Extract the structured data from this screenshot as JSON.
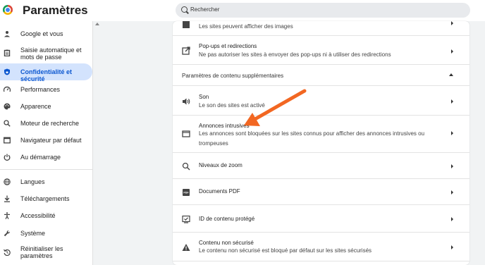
{
  "header": {
    "title": "Paramètres",
    "search_placeholder": "Rechercher"
  },
  "sidebar": {
    "items": [
      {
        "label": "Google et vous",
        "icon": "person-icon"
      },
      {
        "label": "Saisie automatique et mots de passe",
        "icon": "clipboard-icon"
      },
      {
        "label": "Confidentialité et sécurité",
        "icon": "shield-icon",
        "active": true
      },
      {
        "label": "Performances",
        "icon": "speedometer-icon"
      },
      {
        "label": "Apparence",
        "icon": "palette-icon"
      },
      {
        "label": "Moteur de recherche",
        "icon": "search-icon"
      },
      {
        "label": "Navigateur par défaut",
        "icon": "browser-icon"
      },
      {
        "label": "Au démarrage",
        "icon": "power-icon"
      },
      {
        "label": "Langues",
        "icon": "globe-icon"
      },
      {
        "label": "Téléchargements",
        "icon": "download-icon"
      },
      {
        "label": "Accessibilité",
        "icon": "accessibility-icon"
      },
      {
        "label": "Système",
        "icon": "wrench-icon"
      },
      {
        "label": "Réinitialiser les paramètres",
        "icon": "reset-icon"
      }
    ]
  },
  "content": {
    "images_sub": "Les sites peuvent afficher des images",
    "popups": {
      "title": "Pop-ups et redirections",
      "sub": "Ne pas autoriser les sites à envoyer des pop-ups ni à utiliser des redirections"
    },
    "section_title": "Paramètres de contenu supplémentaires",
    "sound": {
      "title": "Son",
      "sub": "Le son des sites est activé"
    },
    "ads": {
      "title": "Annonces intrusives",
      "sub": "Les annonces sont bloquées sur les sites connus pour afficher des annonces intrusives ou trompeuses"
    },
    "zoom": {
      "title": "Niveaux de zoom"
    },
    "pdf": {
      "title": "Documents PDF"
    },
    "protected": {
      "title": "ID de contenu protégé"
    },
    "insecure": {
      "title": "Contenu non sécurisé",
      "sub": "Le contenu non sécurisé est bloqué par défaut sur les sites sécurisés"
    }
  },
  "colors": {
    "accent": "#0b57d0",
    "active_bg": "#d3e3fd",
    "annotation_arrow": "#f26722"
  }
}
